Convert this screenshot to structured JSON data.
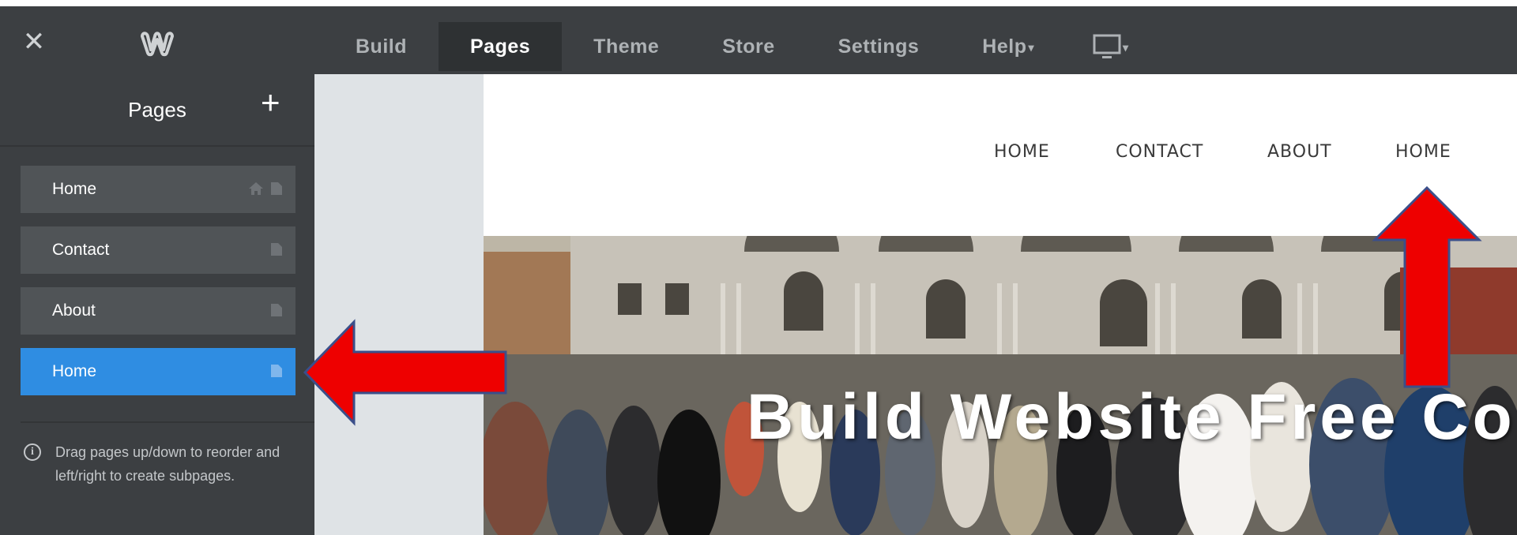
{
  "topbar": {
    "close_icon": "close-icon",
    "logo_icon": "weebly-logo-icon",
    "nav": [
      {
        "label": "Build"
      },
      {
        "label": "Pages"
      },
      {
        "label": "Theme"
      },
      {
        "label": "Store"
      },
      {
        "label": "Settings"
      },
      {
        "label": "Help"
      }
    ],
    "device_icon": "desktop-icon"
  },
  "sidebar": {
    "title": "Pages",
    "add_icon": "plus-icon",
    "pages": [
      {
        "label": "Home"
      },
      {
        "label": "Contact"
      },
      {
        "label": "About"
      },
      {
        "label": "Home"
      }
    ],
    "hint": "Drag pages up/down to reorder and left/right to create subpages."
  },
  "site": {
    "nav": [
      "HOME",
      "CONTACT",
      "ABOUT",
      "HOME"
    ],
    "hero_text": "Build Website Free Co"
  },
  "colors": {
    "topbar_bg": "#3c3f42",
    "active_page": "#2f8de2",
    "annotation_arrow": "#ee0000"
  }
}
